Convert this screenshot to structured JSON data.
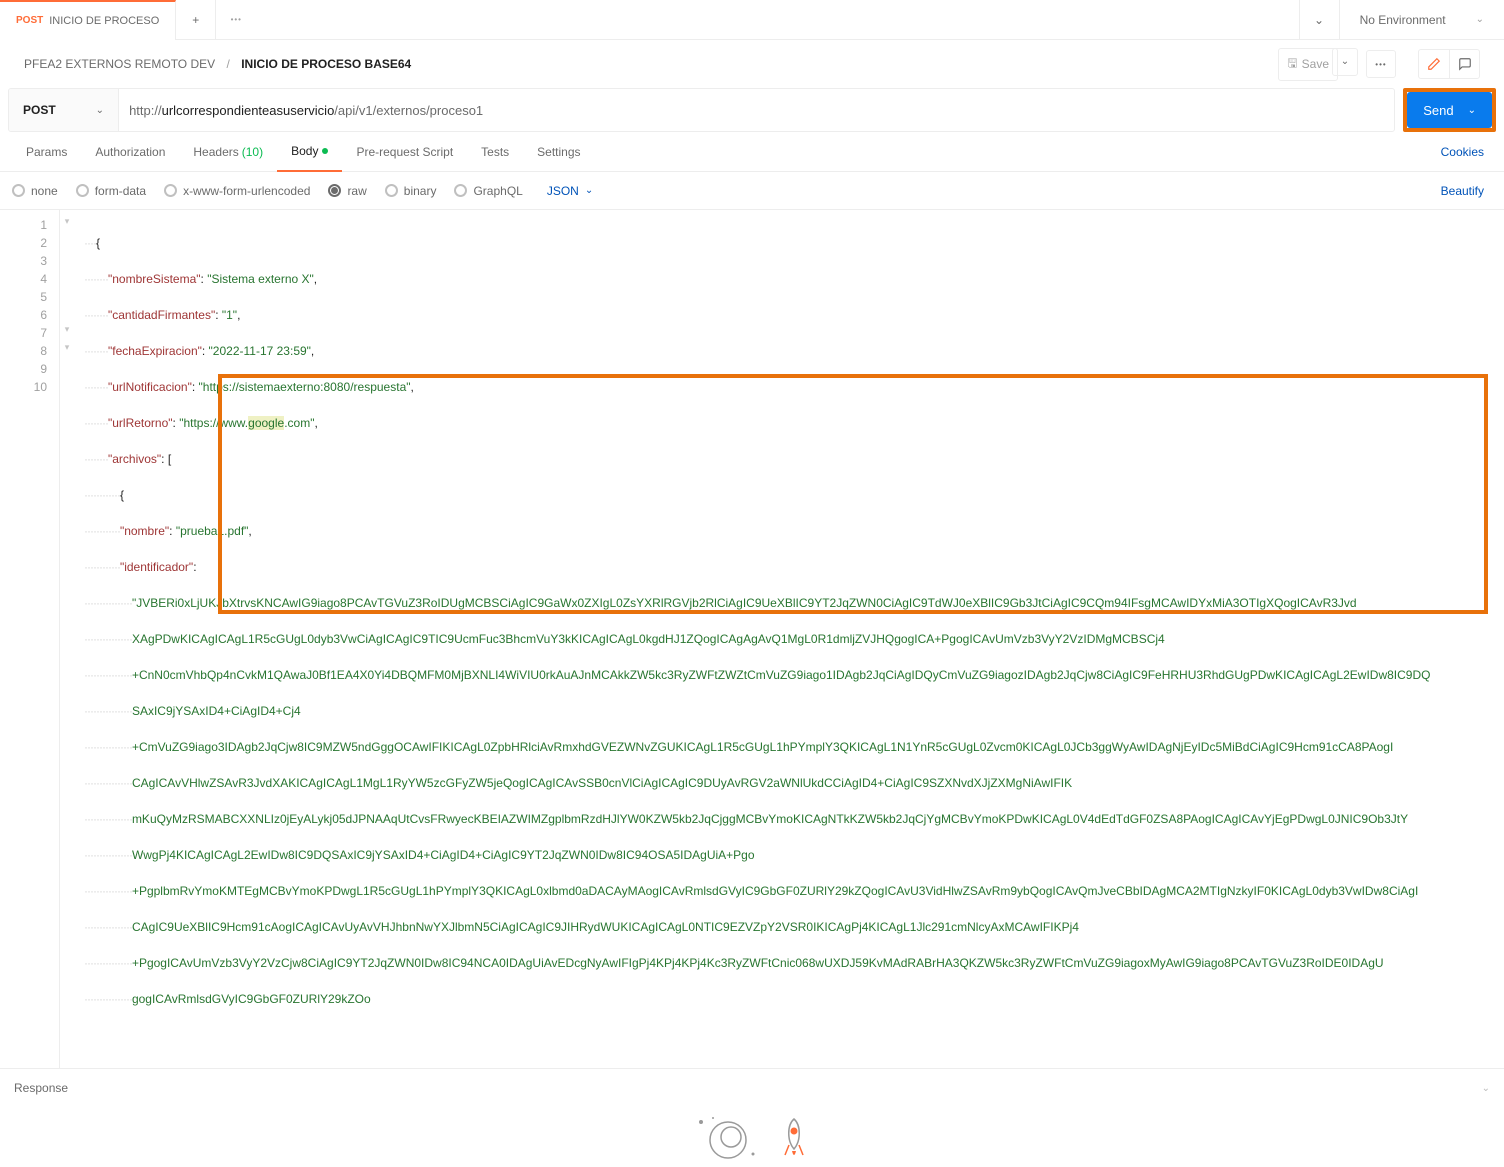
{
  "tab": {
    "method": "POST",
    "title": "INICIO DE PROCESO"
  },
  "tab_actions": {
    "add": "+",
    "more": "•••"
  },
  "env": {
    "chevron": "⌄",
    "label": "No Environment"
  },
  "breadcrumb": {
    "collection": "PFEA2 EXTERNOS REMOTO DEV",
    "sep": "/",
    "current": "INICIO DE PROCESO BASE64"
  },
  "toolbar": {
    "save": "Save",
    "more": "•••"
  },
  "request": {
    "method": "POST",
    "url_scheme": "http://",
    "url_host": "urlcorrespondienteasuservicio",
    "url_path": "/api/v1/externos/proceso1",
    "send": "Send"
  },
  "reqTabs": {
    "params": "Params",
    "authorization": "Authorization",
    "headers": "Headers",
    "headers_count": "(10)",
    "body": "Body",
    "prerequest": "Pre-request Script",
    "tests": "Tests",
    "settings": "Settings",
    "cookies": "Cookies"
  },
  "bodyTypes": {
    "none": "none",
    "formdata": "form-data",
    "urlencoded": "x-www-form-urlencoded",
    "raw": "raw",
    "binary": "binary",
    "graphql": "GraphQL",
    "lang": "JSON",
    "beautify": "Beautify"
  },
  "json": {
    "nombreSistema_k": "\"nombreSistema\"",
    "nombreSistema_v": "\"Sistema externo X\"",
    "cantidadFirmantes_k": "\"cantidadFirmantes\"",
    "cantidadFirmantes_v": "\"1\"",
    "fechaExpiracion_k": "\"fechaExpiracion\"",
    "fechaExpiracion_v": "\"2022-11-17 23:59\"",
    "urlNotificacion_k": "\"urlNotificacion\"",
    "urlNotificacion_v": "\"https://sistemaexterno:8080/respuesta\"",
    "urlRetorno_k": "\"urlRetorno\"",
    "urlRetorno_v_a": "\"https://www.",
    "urlRetorno_v_b": "google",
    "urlRetorno_v_c": ".com\"",
    "archivos_k": "\"archivos\"",
    "nombre_k": "\"nombre\"",
    "nombre_v": "\"prueba1.pdf\"",
    "identificador_k": "\"identificador\"",
    "b64_1": "\"JVBERi0xLjUKJbXtrvsKNCAwIG9iago8PCAvTGVuZ3RoIDUgMCBSCiAgIC9GaWx0ZXIgL0ZsYXRlRGVjb2RlCiAgIC9UeXBlIC9YT2JqZWN0CiAgIC9TdWJ0eXBlIC9Gb3JtCiAgIC9CQm94IFsgMCAwIDYxMiA3OTIgXQogICAvR3Jvd",
    "b64_2": "XAgPDwKICAgICAgL1R5cGUgL0dyb3VwCiAgICAgIC9TIC9UcmFuc3BhcmVuY3kKICAgICAgL0kgdHJ1ZQogICAgAgAvQ1MgL0R1dmljZVJHQgogICA+PgogICAvUmVzb3VyY2VzIDMgMCBSCj4",
    "b64_3": "+CnN0cmVhbQp4nCvkM1QAwaJ0Bf1EA4X0Yi4DBQMFM0MjBXNLI4WiVIU0rkAuAJnMCAkkZW5kc3RyZWFtZWZtCmVuZG9iago1IDAgb2JqCiAgIDQyCmVuZG9iagozIDAgb2JqCjw8CiAgIC9FeHRHU3RhdGUgPDwKICAgICAgL2EwIDw8IC9DQ",
    "b64_4": "SAxIC9jYSAxID4+CiAgID4+Cj4",
    "b64_5": "+CmVuZG9iago3IDAgb2JqCjw8IC9MZW5ndGggOCAwIFIKICAgL0ZpbHRlciAvRmxhdGVEZWNvZGUKICAgL1R5cGUgL1hPYmplY3QKICAgL1N1YnR5cGUgL0Zvcm0KICAgL0JCb3ggWyAwIDAgNjEyIDc5MiBdCiAgIC9Hcm91cCA8PAogI",
    "b64_6": "CAgICAvVHlwZSAvR3JvdXAKICAgICAgL1MgL1RyYW5zcGFyZW5jeQogICAgICAvSSB0cnVlCiAgICAgIC9DUyAvRGV2aWNlUkdCCiAgID4+CiAgIC9SZXNvdXJjZXMgNiAwIFIK",
    "b64_7": "mKuQyMzRSMABCXXNLIz0jEyALykj05dJPNAAqUtCvsFRwyecKBEIAZWIMZgplbmRzdHJlYW0KZW5kb2JqCjggMCBvYmoKICAgNTkKZW5kb2JqCjYgMCBvYmoKPDwKICAgL0V4dEdTdGF0ZSA8PAogICAgICAvYjEgPDwgL0JNIC9Ob3JtY",
    "b64_8": "WwgPj4KICAgICAgL2EwIDw8IC9DQSAxIC9jYSAxID4+CiAgID4+CiAgIC9YT2JqZWN0IDw8IC94OSA5IDAgUiA+Pgo",
    "b64_9": "+PgplbmRvYmoKMTEgMCBvYmoKPDwgL1R5cGUgL1hPYmplY3QKICAgL0xlbmd0aDACAyMAogICAvRmlsdGVyIC9GbGF0ZURlY29kZQogICAvU3VidHlwZSAvRm9ybQogICAvQmJveCBbIDAgMCA2MTIgNzkyIF0KICAgL0dyb3VwIDw8CiAgI",
    "b64_10": "CAgIC9UeXBlIC9Hcm91cAogICAgICAvUyAvVHJhbnNwYXJlbmN5CiAgICAgIC9JIHRydWUKICAgICAgL0NTIC9EZVZpY2VSR0IKICAgPj4KICAgL1Jlc291cmNlcyAxMCAwIFIKPj4",
    "b64_11": "+PgogICAvUmVzb3VyY2VzCjw8CiAgIC9YT2JqZWN0IDw8IC94NCA0IDAgUiAvEDcgNyAwIFIgPj4KPj4KPj4Kc3RyZWFtCnic068wUXDJ59KvMAdRABrHA3QKZW5kc3RyZWFtCmVuZG9iagoxMyAwIG9iago8PCAvTGVuZ3RoIDE0IDAgU",
    "b64_12": "gogICAvRmlsdGVyIC9GbGF0ZURlY29kZOo"
  },
  "lineNumbers": [
    "1",
    "2",
    "3",
    "4",
    "5",
    "6",
    "7",
    "8",
    "9",
    "10"
  ],
  "response": {
    "label": "Response"
  }
}
